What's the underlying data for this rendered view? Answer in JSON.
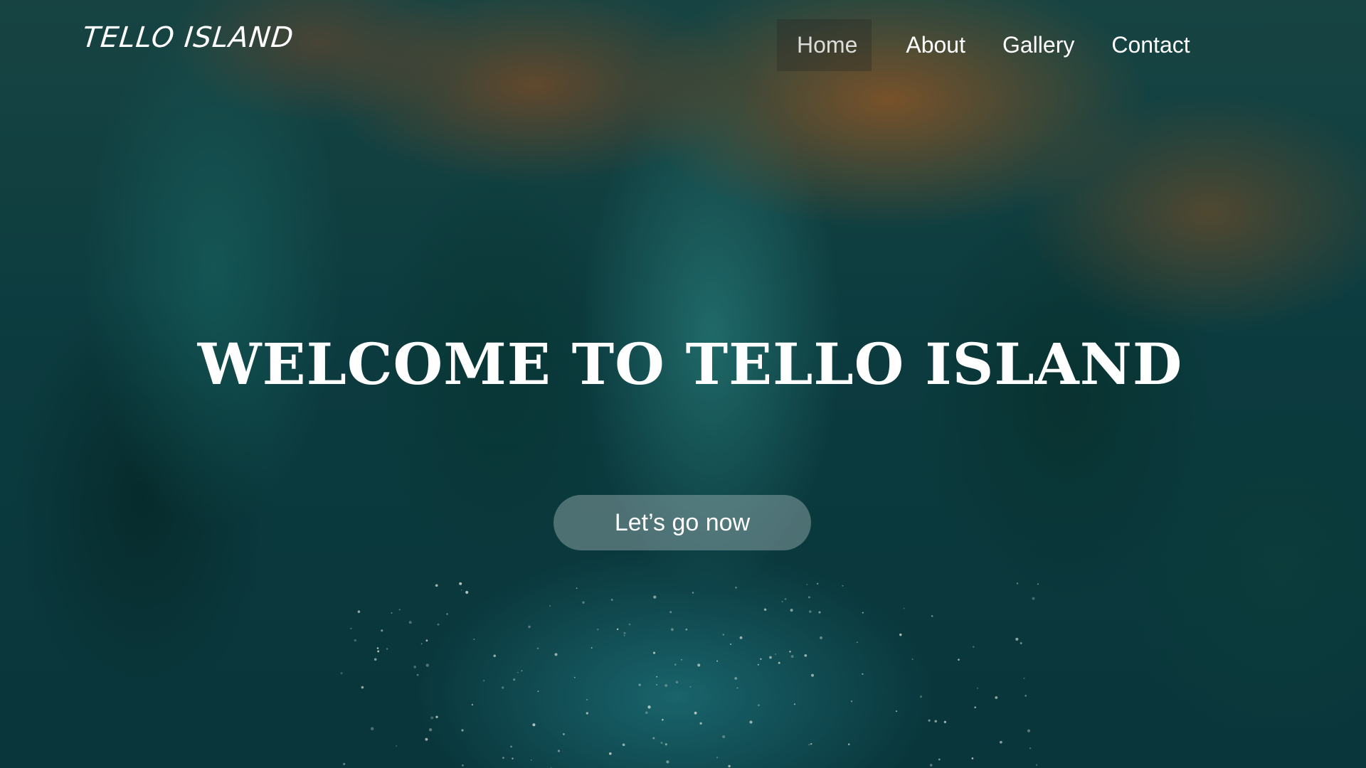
{
  "header": {
    "logo": "TELLO ISLAND"
  },
  "nav": {
    "items": [
      {
        "label": "Home",
        "active": true
      },
      {
        "label": "About",
        "active": false
      },
      {
        "label": "Gallery",
        "active": false
      },
      {
        "label": "Contact",
        "active": false
      }
    ]
  },
  "hero": {
    "title": "WELCOME TO TELLO ISLAND",
    "cta_label": "Let’s go now",
    "background": "aerial view of waterfall and reef"
  },
  "colors": {
    "text": "#ffffff",
    "nav_active_bg": "#282826",
    "button_bg": "#a0b4b6",
    "background_base": "#0f4447"
  }
}
